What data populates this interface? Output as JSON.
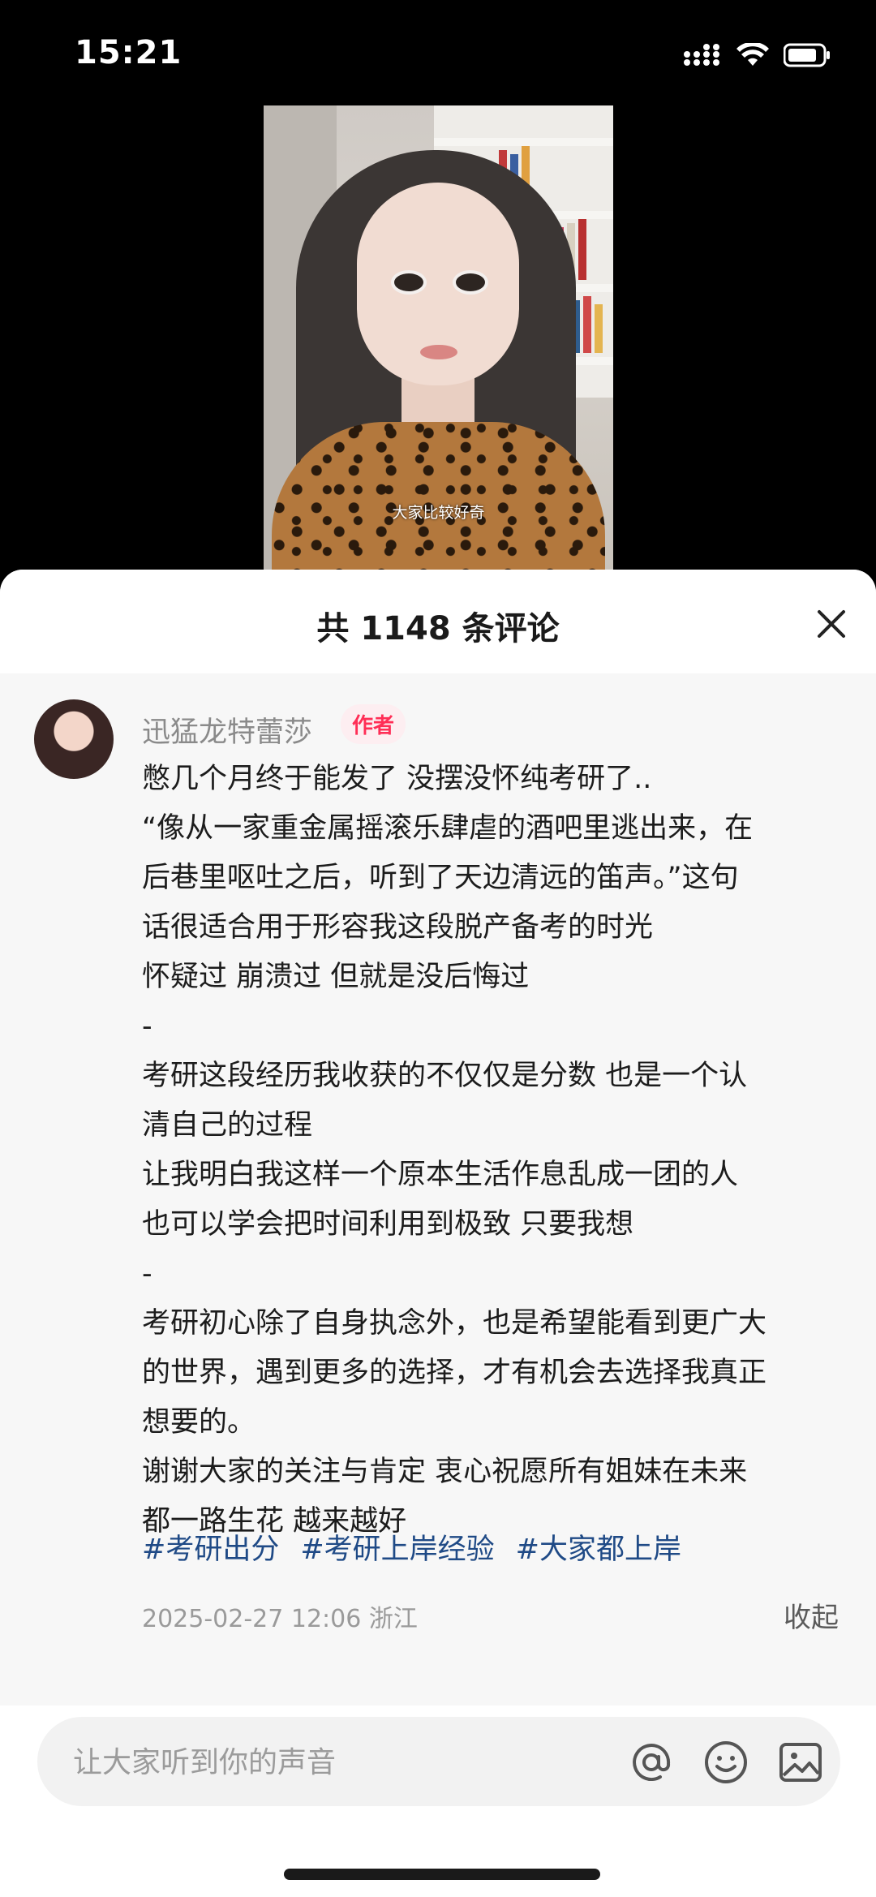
{
  "status_bar": {
    "time": "15:21",
    "icons": [
      "signal-icon",
      "wifi-icon",
      "battery-icon"
    ]
  },
  "video": {
    "subtitle": "大家比较好奇"
  },
  "comments_panel": {
    "title": "共 1148 条评论",
    "close_icon": "close-icon"
  },
  "comment": {
    "author": "迅猛龙特蕾莎",
    "badge": "作者",
    "lines": [
      "憋几个月终于能发了 没摆没怀纯考研了..",
      "“像从一家重金属摇滚乐肆虐的酒吧里逃出来，在",
      "后巷里呕吐之后，听到了天边清远的笛声。”这句",
      "话很适合用于形容我这段脱产备考的时光",
      "怀疑过 崩溃过 但就是没后悔过",
      "-",
      "考研这段经历我收获的不仅仅是分数 也是一个认",
      "清自己的过程",
      "让我明白我这样一个原本生活作息乱成一团的人",
      "也可以学会把时间利用到极致 只要我想",
      "-",
      "考研初心除了自身执念外，也是希望能看到更广大",
      "的世界，遇到更多的选择，才有机会去选择我真正",
      "想要的。",
      "谢谢大家的关注与肯定 衷心祝愿所有姐妹在未来",
      "都一路生花 越来越好"
    ],
    "hashtags": [
      "#考研出分",
      "#考研上岸经验",
      "#大家都上岸"
    ],
    "meta": "2025-02-27 12:06 浙江",
    "collapse_label": "收起"
  },
  "input": {
    "placeholder": "让大家听到你的声音",
    "icons": [
      "at-icon",
      "emoji-icon",
      "image-icon"
    ]
  },
  "colors": {
    "badge_text": "#ff2e56",
    "badge_bg": "#fdeef1",
    "hashtag": "#1f4a86",
    "sheet_bg": "#f7f7f7"
  }
}
